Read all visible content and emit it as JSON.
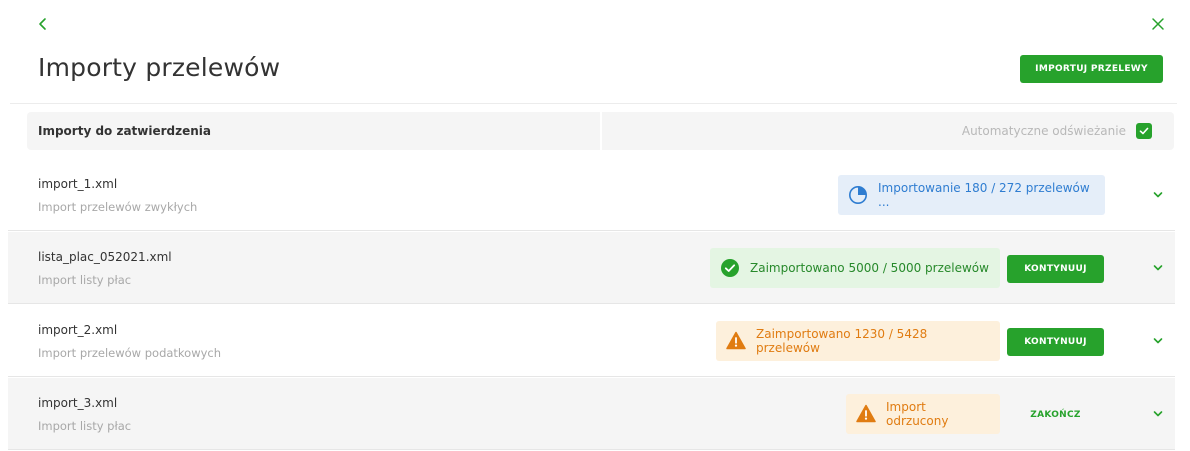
{
  "header": {
    "title": "Importy przelewów",
    "import_button": "IMPORTUJ PRZELEWY",
    "back_icon": "chevron-left-icon",
    "close_icon": "close-icon"
  },
  "filter": {
    "title": "Importy do zatwierdzenia",
    "auto_refresh_label": "Automatyczne odświeżanie",
    "auto_refresh_checked": true
  },
  "imports": [
    {
      "file": "import_1.xml",
      "type": "Import przelewów zwykłych",
      "status": "info",
      "status_text": "Importowanie 180 / 272 przelewów ...",
      "status_icon": "progress-pie-icon",
      "action": ""
    },
    {
      "file": "lista_plac_052021.xml",
      "type": "Import listy płac",
      "status": "success",
      "status_text": "Zaimportowano 5000 / 5000 przelewów",
      "status_icon": "check-circle-icon",
      "action": "KONTYNUUJ"
    },
    {
      "file": "import_2.xml",
      "type": "Import przelewów podatkowych",
      "status": "warning",
      "status_text": "Zaimportowano 1230 / 5428 przelewów",
      "status_icon": "warning-icon",
      "action": "KONTYNUUJ"
    },
    {
      "file": "import_3.xml",
      "type": "Import listy płac",
      "status": "warning",
      "status_text": "Import odrzucony",
      "status_icon": "warning-icon",
      "action": "ZAKOŃCZ"
    }
  ],
  "colors": {
    "accent": "#27a22c",
    "info": "#2f7dd1",
    "warning": "#e07c12"
  }
}
